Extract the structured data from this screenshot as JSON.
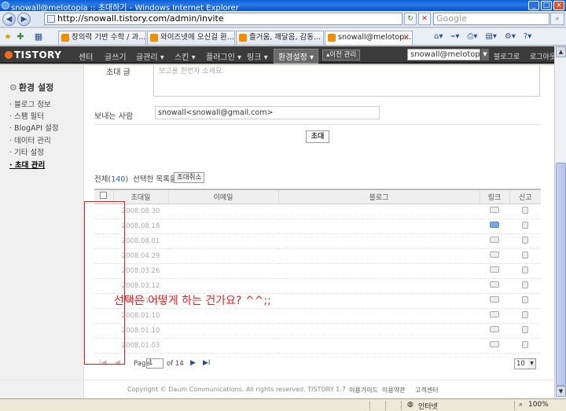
{
  "window": {
    "title": "snowall@melotopia :: 초대하기 - Windows Internet Explorer"
  },
  "address_bar": {
    "url": "http://snowall.tistory.com/admin/invite",
    "search_placeholder": "Google"
  },
  "tabs": [
    {
      "label": "창의력 기반 수학 / 과..."
    },
    {
      "label": "와이즈넷에 오신걸 환..."
    },
    {
      "label": "즐거움, 깨달음, 감동..."
    },
    {
      "label": "snowall@melotop...",
      "active": true
    }
  ],
  "header": {
    "logo": "TISTORY",
    "nav": [
      "센터",
      "글쓰기",
      "글관리 ▾",
      "스킨 ▾",
      "플러그인 ▾",
      "링크 ▾",
      "환경설정 ▾"
    ],
    "active_nav_index": 6,
    "prev_mgmt": "▴이전 관리",
    "user": "snowall@melotopia",
    "blog_link": "블로그로",
    "logout": "로그아웃"
  },
  "sidebar": {
    "title": "환경 설정",
    "items": [
      "블로그 정보",
      "스팸 필터",
      "BlogAPI 설정",
      "데이터 관리",
      "기타 설정",
      "초대 관리"
    ],
    "active_index": 5
  },
  "form": {
    "message_placeholder": "보고를 한번자 소세요.",
    "message_label": "초대 글",
    "sender_label": "보내는 사람",
    "sender_value": "snowall<snowall@gmail.com>",
    "invite_button": "초대"
  },
  "list": {
    "total_label": "전체(",
    "total_count": "140",
    "total_close": ")",
    "selected_label": "선택한 목록을",
    "cancel_button": "초대취소",
    "columns": [
      "초대일",
      "이메일",
      "블로그",
      "링크",
      "신고"
    ],
    "rows": [
      {
        "date": "2008.08.30",
        "link_active": false
      },
      {
        "date": "2008.08.18",
        "link_active": true
      },
      {
        "date": "2008.08.01",
        "link_active": false
      },
      {
        "date": "2008.04.29",
        "link_active": false
      },
      {
        "date": "2008.03.26",
        "link_active": false
      },
      {
        "date": "2008.03.12",
        "link_active": false
      },
      {
        "date": "2008.01.10",
        "link_active": false
      },
      {
        "date": "2008.01.10",
        "link_active": false
      },
      {
        "date": "2008.01.10",
        "link_active": false
      },
      {
        "date": "2008.01.03",
        "link_active": false
      }
    ]
  },
  "pager": {
    "page_label": "Page",
    "page_value": "1",
    "of_label": "of 14",
    "per_page": "10"
  },
  "footer": {
    "copyright": "Copyright © Daum Communications. All rights reserved. TISTORY 1.7",
    "links": [
      "이용가이드",
      "이용약관",
      "고객센터"
    ]
  },
  "annotation": {
    "text": "선택은 어떻게 하는 건가요? ^^;;",
    "color": "#e02020"
  },
  "status_bar": {
    "zone": "인터넷",
    "zoom": "100%"
  }
}
